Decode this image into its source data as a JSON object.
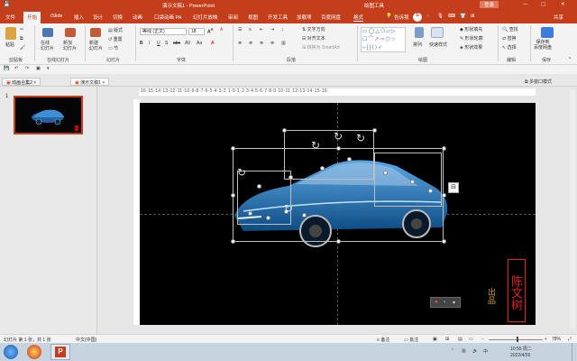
{
  "titlebar": {
    "doc_title": "演示文稿1  -  PowerPoint",
    "tool_label": "绘图工具",
    "login": "登录",
    "min": "—",
    "max": "▢",
    "close": "✕"
  },
  "tabs": [
    "文件",
    "开始",
    "iSlide",
    "插入",
    "设计",
    "切换",
    "动画",
    "口袋动画 PA",
    "幻灯片放映",
    "审阅",
    "视图",
    "开发工具",
    "加载项",
    "百度网盘",
    "格式"
  ],
  "tell_me": "告诉我",
  "share": "共享",
  "ribbon": {
    "paste": "粘贴",
    "new_slide": "新建\n幻灯片",
    "layout": "版式",
    "reset": "重置",
    "section": "节",
    "online_pic": "在线\n幻灯片",
    "new_style": "新加\n幻灯片",
    "font_name": "等线 (正文)",
    "font_size": "18",
    "text_dir": "文字方向",
    "align_text": "对齐文本",
    "smartart": "转换为 SmartArt",
    "arrange": "排列",
    "quick_styles": "快速样式",
    "shape_fill": "形状填充",
    "shape_outline": "形状轮廓",
    "shape_effect": "形状效果",
    "find": "查找",
    "replace": "替换",
    "select": "选择",
    "save_baidu": "保存到\n百度网盘",
    "groups": [
      "剪贴板",
      "在线幻灯片",
      "幻灯片",
      "字体",
      "段落",
      "绘图",
      "编辑",
      "保存"
    ]
  },
  "doc_tabs": [
    "动画合集2",
    "演示文稿1"
  ],
  "multi_window": "多窗口模式",
  "slide_number": "1",
  "ruler_text": "·16·15·14·13·12·11·10·9·8·7·6·5·4·3·2·1·0·1·2·3·4·5·6·7·8·9·10·11·12·13·14·15·16·",
  "signature": "陈文树",
  "signature_small": "出品",
  "status": {
    "slide_info": "幻灯片 第 1 张，共 1 张",
    "lang": "中文(中国)",
    "notes": "备注",
    "comments": "批注",
    "zoom": "78%"
  },
  "taskbar": {
    "time": "10:55 周二",
    "date": "2022/4/26"
  }
}
